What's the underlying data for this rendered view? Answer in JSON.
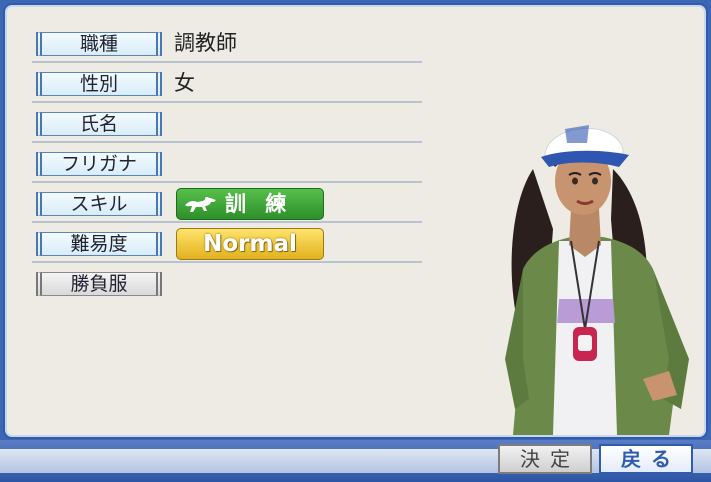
{
  "fields": [
    {
      "label": "職種",
      "value": "調教師"
    },
    {
      "label": "性別",
      "value": "女"
    },
    {
      "label": "氏名",
      "value": ""
    },
    {
      "label": "フリガナ",
      "value": ""
    },
    {
      "label": "スキル",
      "badge": "訓 練",
      "badge_icon": "horse-icon"
    },
    {
      "label": "難易度",
      "badge": "Normal"
    },
    {
      "label": "勝負服",
      "disabled": true
    }
  ],
  "buttons": {
    "confirm": "決定",
    "back": "戻る"
  },
  "colors": {
    "frame": "#2f5cad",
    "panel": "#edebe4",
    "skill_badge": "#3a9e33",
    "difficulty_badge": "#f0c534"
  }
}
